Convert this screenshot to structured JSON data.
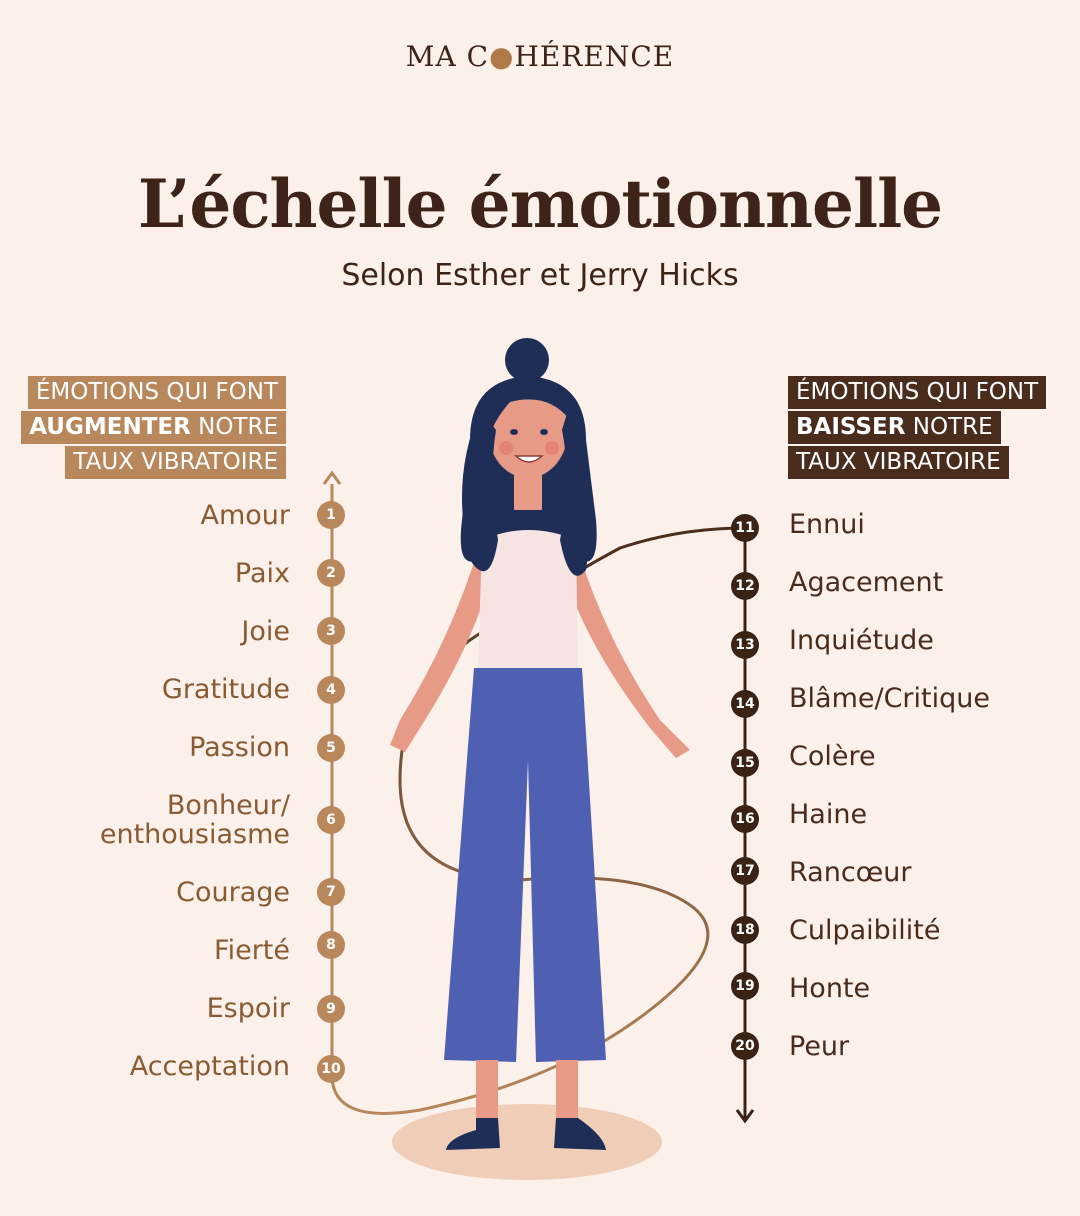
{
  "brand": {
    "pre": "MA C",
    "post": "HÉRENCE"
  },
  "title": "L’échelle émotionnelle",
  "subtitle": "Selon Esther et Jerry Hicks",
  "left_box": {
    "line1": "ÉMOTIONS QUI FONT",
    "bold": "AUGMENTER",
    "line2_rest": " NOTRE",
    "line3": "TAUX VIBRATOIRE"
  },
  "right_box": {
    "line1": "ÉMOTIONS QUI FONT",
    "bold": "BAISSER",
    "line2_rest": " NOTRE",
    "line3": "TAUX VIBRATOIRE"
  },
  "left_items": [
    {
      "n": "1",
      "label": "Amour"
    },
    {
      "n": "2",
      "label": "Paix"
    },
    {
      "n": "3",
      "label": "Joie"
    },
    {
      "n": "4",
      "label": "Gratitude"
    },
    {
      "n": "5",
      "label": "Passion"
    },
    {
      "n": "6",
      "label": "Bonheur/\nenthousiasme"
    },
    {
      "n": "7",
      "label": "Courage"
    },
    {
      "n": "8",
      "label": "Fierté"
    },
    {
      "n": "9",
      "label": "Espoir"
    },
    {
      "n": "10",
      "label": "Acceptation"
    }
  ],
  "right_items": [
    {
      "n": "11",
      "label": "Ennui"
    },
    {
      "n": "12",
      "label": "Agacement"
    },
    {
      "n": "13",
      "label": "Inquiétude"
    },
    {
      "n": "14",
      "label": "Blâme/Critique"
    },
    {
      "n": "15",
      "label": "Colère"
    },
    {
      "n": "16",
      "label": "Haine"
    },
    {
      "n": "17",
      "label": "Rancœur"
    },
    {
      "n": "18",
      "label": "Culpaibilité"
    },
    {
      "n": "19",
      "label": "Honte"
    },
    {
      "n": "20",
      "label": "Peur"
    }
  ],
  "colors": {
    "accent_light": "#b8875c",
    "accent_dark": "#4a2c1d",
    "background": "#fbf1ea",
    "skin": "#e79a85",
    "hair": "#1f2e56",
    "pants": "#4f5fb2",
    "top": "#f6e4e2"
  }
}
